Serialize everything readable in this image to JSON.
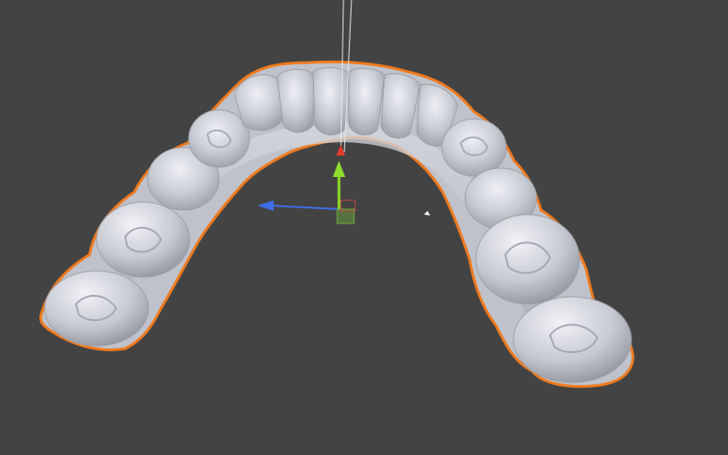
{
  "viewport": {
    "background": "#434343",
    "model": {
      "kind": "dental-arch-scan",
      "selected": true,
      "selection_outline_color": "#f07a1e",
      "surface_color": "#c9ccd3"
    },
    "gizmo": {
      "type": "transform-gizmo",
      "axes": [
        {
          "name": "x",
          "color": "#e23b2a"
        },
        {
          "name": "y",
          "color": "#8fdc2a"
        },
        {
          "name": "z",
          "color": "#3d6fe8"
        }
      ],
      "plane_handle_color": "#6fae3a",
      "pivot_line_color": "#e8e8e8"
    }
  }
}
